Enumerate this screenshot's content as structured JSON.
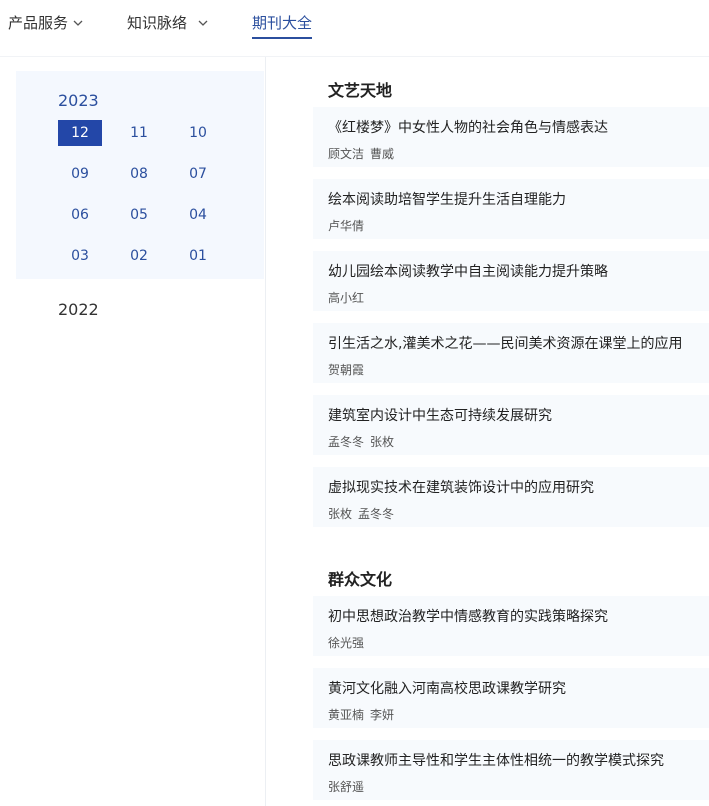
{
  "nav": {
    "items": [
      {
        "label": "产品服务",
        "has_dropdown": true
      },
      {
        "label": "知识脉络",
        "has_dropdown": true
      },
      {
        "label": "期刊大全",
        "has_dropdown": false,
        "active": true
      }
    ]
  },
  "sidebar": {
    "years": [
      {
        "year": "2023",
        "expanded": true,
        "months": [
          "12",
          "11",
          "10",
          "09",
          "08",
          "07",
          "06",
          "05",
          "04",
          "03",
          "02",
          "01"
        ],
        "selected_month": "12"
      },
      {
        "year": "2022",
        "expanded": false
      }
    ]
  },
  "sections": [
    {
      "title": "文艺天地",
      "articles": [
        {
          "title": "《红楼梦》中女性人物的社会角色与情感表达",
          "authors": [
            "顾文洁",
            "曹威"
          ]
        },
        {
          "title": "绘本阅读助培智学生提升生活自理能力",
          "authors": [
            "卢华倩"
          ]
        },
        {
          "title": "幼儿园绘本阅读教学中自主阅读能力提升策略",
          "authors": [
            "高小红"
          ]
        },
        {
          "title": "引生活之水,灌美术之花——民间美术资源在课堂上的应用",
          "authors": [
            "贺朝霞"
          ]
        },
        {
          "title": "建筑室内设计中生态可持续发展研究",
          "authors": [
            "孟冬冬",
            "张枚"
          ]
        },
        {
          "title": "虚拟现实技术在建筑装饰设计中的应用研究",
          "authors": [
            "张枚",
            "孟冬冬"
          ]
        }
      ]
    },
    {
      "title": "群众文化",
      "articles": [
        {
          "title": "初中思想政治教学中情感教育的实践策略探究",
          "authors": [
            "徐光强"
          ]
        },
        {
          "title": "黄河文化融入河南高校思政课教学研究",
          "authors": [
            "黄亚楠",
            "李妍"
          ]
        },
        {
          "title": "思政课教师主导性和学生主体性相统一的教学模式探究",
          "authors": [
            "张舒遥"
          ]
        }
      ]
    }
  ],
  "colors": {
    "accent": "#2b4f9e",
    "selected_bg": "#2347a8",
    "panel_bg": "#f4f8fe",
    "card_bg": "#f7fafd"
  }
}
